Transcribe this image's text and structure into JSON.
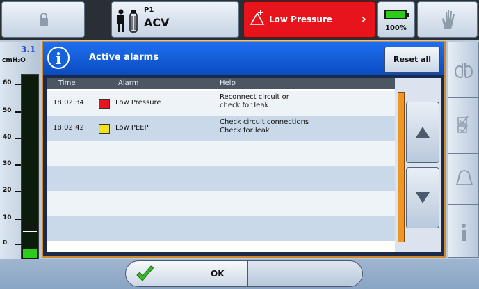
{
  "topbar": {
    "patient": "P1",
    "mode": "ACV",
    "alarm_label": "Low Pressure",
    "alarm_color": "#e8141b",
    "battery_pct": "100%",
    "battery_level": 1.0,
    "icons": [
      "lock-icon",
      "patient-icon",
      "circuit-icon",
      "alarm-add-icon",
      "chevron-right-icon",
      "battery-icon",
      "hand-icon"
    ]
  },
  "gauge": {
    "value": "3.1",
    "unit": "cmH₂O",
    "ticks": [
      "60",
      "50",
      "40",
      "30",
      "20",
      "10",
      "0"
    ],
    "level_fraction": 0.05
  },
  "dialog": {
    "title": "Active alarms",
    "reset_label": "Reset all",
    "columns": [
      "Time",
      "Alarm",
      "Help"
    ],
    "rows": [
      {
        "time": "18:02:34",
        "alarm": "Low Pressure",
        "help1": "Reconnect circuit or",
        "help2": "check for leak",
        "color": "#e8141b"
      },
      {
        "time": "18:02:42",
        "alarm": "Low PEEP",
        "help1": "Check circuit connections",
        "help2": "Check for leak",
        "color": "#f2e21a"
      }
    ]
  },
  "sidebar": {
    "icons": [
      "lungs-icon",
      "checklist-icon",
      "bell-icon",
      "info-icon"
    ]
  },
  "footer": {
    "ok_label": "OK"
  },
  "colors": {
    "accent": "#1e6ff0",
    "scroll": "#f09626",
    "gauge_fill": "#2ecc1a"
  }
}
